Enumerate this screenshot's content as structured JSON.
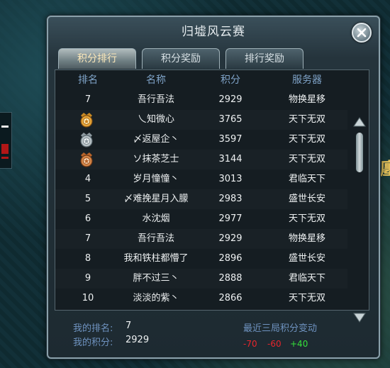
{
  "window": {
    "title": "归墟风云赛"
  },
  "tabs": [
    {
      "label": "积分排行",
      "active": true
    },
    {
      "label": "积分奖励",
      "active": false
    },
    {
      "label": "排行奖励",
      "active": false
    }
  ],
  "table": {
    "headers": {
      "rank": "排名",
      "name": "名称",
      "score": "积分",
      "server": "服务器"
    },
    "rows": [
      {
        "rank": "7",
        "name": "吾行吾法",
        "score": "2929",
        "server": "物换星移",
        "medal": null
      },
      {
        "rank": "",
        "name": "乀知微心",
        "score": "3765",
        "server": "天下无双",
        "medal": "gold"
      },
      {
        "rank": "",
        "name": "〆返屋企丶",
        "score": "3597",
        "server": "天下无双",
        "medal": "silver"
      },
      {
        "rank": "",
        "name": "ソ抹茶芝士",
        "score": "3144",
        "server": "天下无双",
        "medal": "bronze"
      },
      {
        "rank": "4",
        "name": "岁月憧憧丶",
        "score": "3013",
        "server": "君临天下",
        "medal": null
      },
      {
        "rank": "5",
        "name": "〆难挽星月入朦",
        "score": "2983",
        "server": "盛世长安",
        "medal": null
      },
      {
        "rank": "6",
        "name": "水沈烟",
        "score": "2977",
        "server": "天下无双",
        "medal": null
      },
      {
        "rank": "7",
        "name": "吾行吾法",
        "score": "2929",
        "server": "物换星移",
        "medal": null
      },
      {
        "rank": "8",
        "name": "我和铁柱都懵了",
        "score": "2896",
        "server": "盛世长安",
        "medal": null
      },
      {
        "rank": "9",
        "name": "胖不过三丶",
        "score": "2888",
        "server": "君临天下",
        "medal": null
      },
      {
        "rank": "10",
        "name": "淡淡的紫丶",
        "score": "2866",
        "server": "天下无双",
        "medal": null
      }
    ]
  },
  "footer": {
    "my_rank_label": "我的排名:",
    "my_rank": "7",
    "my_score_label": "我的积分:",
    "my_score": "2929",
    "recent_label": "最近三局积分变动",
    "deltas": [
      {
        "value": "-70",
        "color": "#e8252c"
      },
      {
        "value": "-60",
        "color": "#e8252c"
      },
      {
        "value": "+40",
        "color": "#35e03a"
      }
    ]
  },
  "background": {
    "right_glyph": "廛"
  },
  "icons": {
    "close": "close-icon",
    "scroll_up": "chevron-up-icon",
    "scroll_down": "chevron-down-icon",
    "medals": [
      "gold-medal-icon",
      "silver-medal-icon",
      "bronze-medal-icon"
    ]
  },
  "colors": {
    "header_text": "#7fa3c8",
    "tab_active_text": "#fbe7b9",
    "negative": "#e8252c",
    "positive": "#35e03a"
  }
}
